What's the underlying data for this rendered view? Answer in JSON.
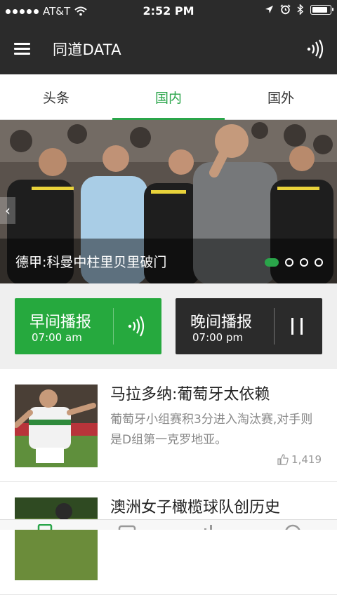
{
  "status_bar": {
    "carrier": "AT&T",
    "time": "2:52 PM",
    "battery_level": 0.9
  },
  "navbar": {
    "title": "同道DATA",
    "menu_icon": "hamburger-icon",
    "audio_icon": "audio-waves-icon"
  },
  "tabs": [
    {
      "label": "头条",
      "active": false
    },
    {
      "label": "国内",
      "active": true
    },
    {
      "label": "国外",
      "active": false
    }
  ],
  "banner": {
    "caption": "德甲:科曼中柱里贝里破门",
    "page_count": 4,
    "active_page": 0
  },
  "broadcasts": {
    "morning": {
      "title": "早间播报",
      "time": "07:00 am",
      "icon": "audio-waves-icon"
    },
    "evening": {
      "title": "晚间播报",
      "time": "07:00 pm",
      "icon": "pause-icon"
    }
  },
  "news": [
    {
      "title": "马拉多纳:葡萄牙太依赖",
      "summary": "葡萄牙小组赛积3分进入淘汰赛,对手则是D组第一克罗地亚。",
      "likes": "1,419"
    },
    {
      "title": "澳洲女子橄榄球队创历史",
      "summary": "",
      "likes": ""
    }
  ],
  "colors": {
    "accent": "#2aa54a",
    "dark": "#2b2b2b"
  }
}
